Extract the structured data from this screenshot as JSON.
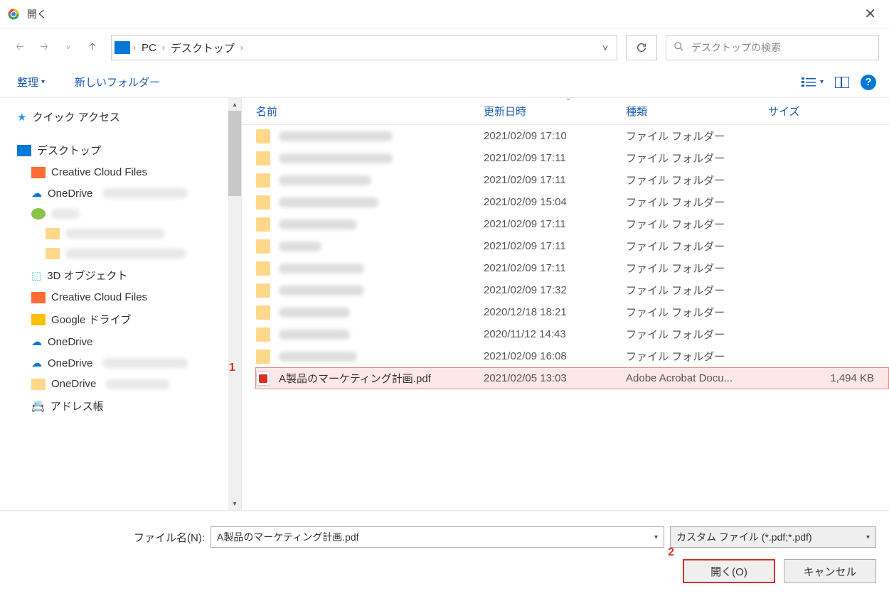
{
  "dialog": {
    "title": "開く"
  },
  "breadcrumb": {
    "pc": "PC",
    "desktop": "デスクトップ"
  },
  "search": {
    "placeholder": "デスクトップの検索"
  },
  "toolbar": {
    "organize": "整理",
    "new_folder": "新しいフォルダー"
  },
  "sidebar": {
    "quick_access": "クイック アクセス",
    "desktop": "デスクトップ",
    "ccf": "Creative Cloud Files",
    "onedrive": "OneDrive",
    "obj3d": "3D オブジェクト",
    "ccf2": "Creative Cloud Files",
    "gdrive": "Google ドライブ",
    "onedrive2": "OneDrive",
    "onedrive3": "OneDrive",
    "onedrive4": "OneDrive",
    "address": "アドレス帳"
  },
  "columns": {
    "name": "名前",
    "date": "更新日時",
    "type": "種類",
    "size": "サイズ"
  },
  "files": [
    {
      "date": "2021/02/09 17:10",
      "type": "ファイル フォルダー",
      "blur_w": 160
    },
    {
      "date": "2021/02/09 17:11",
      "type": "ファイル フォルダー",
      "blur_w": 160
    },
    {
      "date": "2021/02/09 17:11",
      "type": "ファイル フォルダー",
      "blur_w": 130
    },
    {
      "date": "2021/02/09 15:04",
      "type": "ファイル フォルダー",
      "blur_w": 140
    },
    {
      "date": "2021/02/09 17:11",
      "type": "ファイル フォルダー",
      "blur_w": 110
    },
    {
      "date": "2021/02/09 17:11",
      "type": "ファイル フォルダー",
      "blur_w": 60
    },
    {
      "date": "2021/02/09 17:11",
      "type": "ファイル フォルダー",
      "blur_w": 120
    },
    {
      "date": "2021/02/09 17:32",
      "type": "ファイル フォルダー",
      "blur_w": 120
    },
    {
      "date": "2020/12/18 18:21",
      "type": "ファイル フォルダー",
      "blur_w": 100
    },
    {
      "date": "2020/11/12 14:43",
      "type": "ファイル フォルダー",
      "blur_w": 100
    },
    {
      "date": "2021/02/09 16:08",
      "type": "ファイル フォルダー",
      "blur_w": 110
    }
  ],
  "selected_file": {
    "name": "A製品のマーケティング計画.pdf",
    "date": "2021/02/05 13:03",
    "type": "Adobe Acrobat Docu...",
    "size": "1,494 KB"
  },
  "callouts": {
    "one": "1",
    "two": "2"
  },
  "bottom": {
    "filename_label": "ファイル名(N):",
    "filename_value": "A製品のマーケティング計画.pdf",
    "filter": "カスタム ファイル (*.pdf;*.pdf)",
    "open": "開く(O)",
    "cancel": "キャンセル"
  }
}
